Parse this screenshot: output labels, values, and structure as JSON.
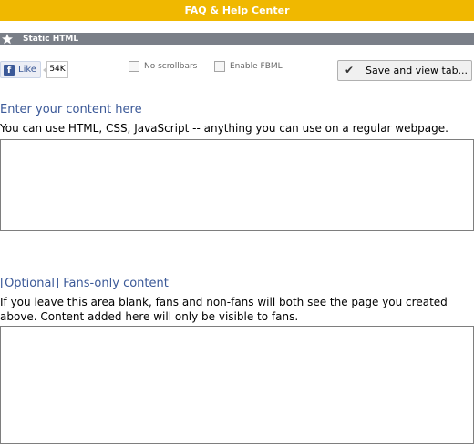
{
  "header": {
    "title": "FAQ & Help Center"
  },
  "section": {
    "title": "Static HTML",
    "icon": "star-icon"
  },
  "like": {
    "label": "Like",
    "count": "54K",
    "icon": "facebook-icon"
  },
  "options": {
    "no_scrollbars": "No scrollbars",
    "enable_fbml": "Enable FBML"
  },
  "save_button": {
    "label": "Save and view tab...",
    "icon": "checkmark-icon"
  },
  "content": {
    "heading": "Enter your content here",
    "description": "You can use HTML, CSS, JavaScript -- anything you can use on a regular webpage.",
    "value": ""
  },
  "fans_content": {
    "heading": "[Optional] Fans-only content",
    "description": "If you leave this area blank, fans and non-fans will both see the page you created above. Content added here will only be visible to fans.",
    "value": ""
  },
  "colors": {
    "header_bg": "#f0b800",
    "section_bg": "#7a7f88",
    "link_blue": "#3b5998"
  }
}
